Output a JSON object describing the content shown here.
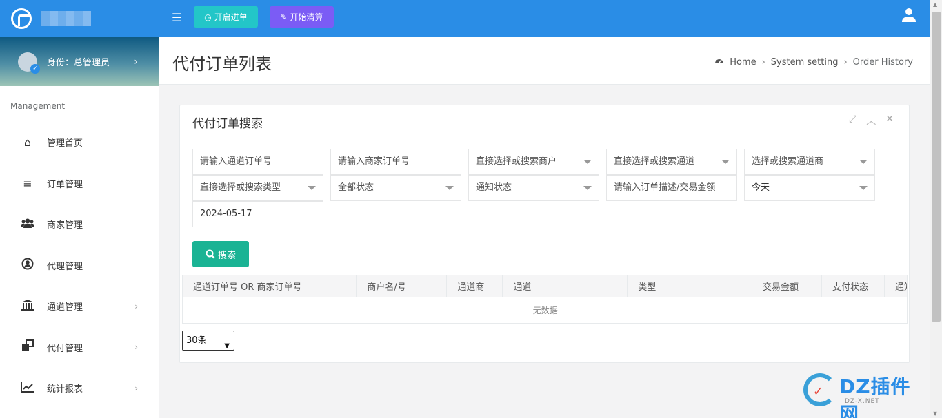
{
  "topbar": {
    "open_label": "开启进单",
    "settle_label": "开始清算"
  },
  "sidebar": {
    "role": "身份：总管理员",
    "section": "Management",
    "items": [
      {
        "label": "管理首页",
        "icon": "home-icon"
      },
      {
        "label": "订单管理",
        "icon": "list-icon"
      },
      {
        "label": "商家管理",
        "icon": "users-icon"
      },
      {
        "label": "代理管理",
        "icon": "user-circle-icon"
      },
      {
        "label": "通道管理",
        "icon": "bank-icon"
      },
      {
        "label": "代付管理",
        "icon": "clone-icon"
      },
      {
        "label": "统计报表",
        "icon": "chart-icon"
      }
    ]
  },
  "page": {
    "title": "代付订单列表",
    "breadcrumb": [
      "Home",
      "System setting",
      "Order History"
    ]
  },
  "panel": {
    "title": "代付订单搜索",
    "fields": {
      "channel_order_no": "请输入通道订单号",
      "merchant_order_no": "请输入商家订单号",
      "merchant_select": "直接选择或搜索商户",
      "channel_select": "直接选择或搜索通道",
      "provider_select": "选择或搜索通道商",
      "type_select": "直接选择或搜索类型",
      "status_select": "全部状态",
      "notify_select": "通知状态",
      "desc_amount": "请输入订单描述/交易金额",
      "date_range": "今天",
      "date": "2024-05-17"
    },
    "search_label": "搜索",
    "table": {
      "headers": [
        "通道订单号 OR 商家订单号",
        "商户名/号",
        "通道商",
        "通道",
        "类型",
        "交易金额",
        "支付状态",
        "通知"
      ],
      "empty": "无数据"
    },
    "page_size": "30条"
  },
  "watermark": {
    "brand": "DZ插件网",
    "url": "DZ-X.NET"
  }
}
